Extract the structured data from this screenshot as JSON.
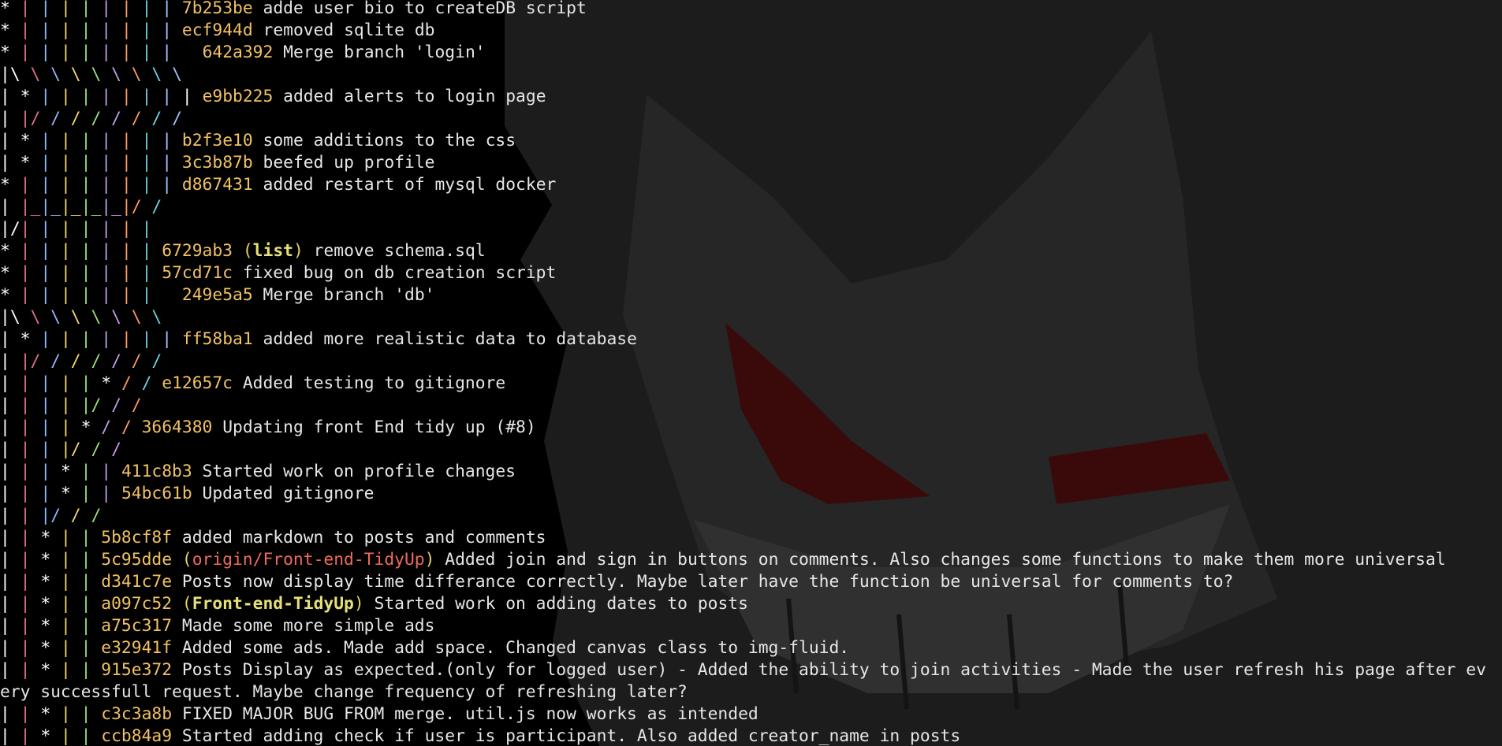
{
  "colors": {
    "background": "#000000",
    "hash": "#f2c263",
    "message": "#e6e6e6",
    "ref_local": "#e6e07a",
    "ref_remote": "#f06a5a",
    "wallpaper_figure": "#2a2a2a",
    "wallpaper_eyes": "#3d0b0b"
  },
  "wallpaper": {
    "description_icon": "gengar-wallpaper-icon"
  },
  "lines": [
    {
      "graph": "* | | | | | | | | ",
      "hash": "7b253be",
      "refs": "",
      "message": "adde user bio to createDB script"
    },
    {
      "graph": "* | | | | | | | | ",
      "hash": "ecf944d",
      "refs": "",
      "message": "removed sqlite db"
    },
    {
      "graph": "* | | | | | | | |   ",
      "hash": "642a392",
      "refs": "",
      "message": "Merge branch 'login'"
    },
    {
      "graph": "|\\ \\ \\ \\ \\ \\ \\ \\ \\",
      "hash": "",
      "refs": "",
      "message": ""
    },
    {
      "graph": "| * | | | | | | | | ",
      "hash": "e9bb225",
      "refs": "",
      "message": "added alerts to login page"
    },
    {
      "graph": "| |/ / / / / / / /",
      "hash": "",
      "refs": "",
      "message": ""
    },
    {
      "graph": "| * | | | | | | | ",
      "hash": "b2f3e10",
      "refs": "",
      "message": "some additions to the css"
    },
    {
      "graph": "| * | | | | | | | ",
      "hash": "3c3b87b",
      "refs": "",
      "message": "beefed up profile"
    },
    {
      "graph": "* | | | | | | | | ",
      "hash": "d867431",
      "refs": "",
      "message": "added restart of mysql docker"
    },
    {
      "graph": "| |_|_|_|_|_|/ /",
      "hash": "",
      "refs": "",
      "message": ""
    },
    {
      "graph": "|/| | | | | | |",
      "hash": "",
      "refs": "",
      "message": ""
    },
    {
      "graph": "* | | | | | | | ",
      "hash": "6729ab3",
      "refs": "list",
      "refType": "local",
      "message": "remove schema.sql"
    },
    {
      "graph": "* | | | | | | | ",
      "hash": "57cd71c",
      "refs": "",
      "message": "fixed bug on db creation script"
    },
    {
      "graph": "* | | | | | | |   ",
      "hash": "249e5a5",
      "refs": "",
      "message": "Merge branch 'db'"
    },
    {
      "graph": "|\\ \\ \\ \\ \\ \\ \\ \\",
      "hash": "",
      "refs": "",
      "message": ""
    },
    {
      "graph": "| * | | | | | | | ",
      "hash": "ff58ba1",
      "refs": "",
      "message": "added more realistic data to database"
    },
    {
      "graph": "| |/ / / / / / /",
      "hash": "",
      "refs": "",
      "message": ""
    },
    {
      "graph": "| | | | | * / / ",
      "hash": "e12657c",
      "refs": "",
      "message": "Added testing to gitignore"
    },
    {
      "graph": "| | | | |/ / /",
      "hash": "",
      "refs": "",
      "message": ""
    },
    {
      "graph": "| | | | * / / ",
      "hash": "3664380",
      "refs": "",
      "message": "Updating front End tidy up (#8)"
    },
    {
      "graph": "| | | |/ / /",
      "hash": "",
      "refs": "",
      "message": ""
    },
    {
      "graph": "| | | * | | ",
      "hash": "411c8b3",
      "refs": "",
      "message": "Started work on profile changes"
    },
    {
      "graph": "| | | * | | ",
      "hash": "54bc61b",
      "refs": "",
      "message": "Updated gitignore"
    },
    {
      "graph": "| | |/ / /",
      "hash": "",
      "refs": "",
      "message": ""
    },
    {
      "graph": "| | * | | ",
      "hash": "5b8cf8f",
      "refs": "",
      "message": "added markdown to posts and comments"
    },
    {
      "graph": "| | * | | ",
      "hash": "5c95dde",
      "refs": "origin/Front-end-TidyUp",
      "refType": "remote",
      "message": "Added join and sign in buttons on comments. Also changes some functions to make them more universal"
    },
    {
      "graph": "| | * | | ",
      "hash": "d341c7e",
      "refs": "",
      "message": "Posts now display time differance correctly. Maybe later have the function be universal for comments to?"
    },
    {
      "graph": "| | * | | ",
      "hash": "a097c52",
      "refs": "Front-end-TidyUp",
      "refType": "local",
      "message": "Started work on adding dates to posts"
    },
    {
      "graph": "| | * | | ",
      "hash": "a75c317",
      "refs": "",
      "message": "Made some more simple ads"
    },
    {
      "graph": "| | * | | ",
      "hash": "e32941f",
      "refs": "",
      "message": "Added some ads. Made add space. Changed canvas class to img-fluid."
    },
    {
      "graph": "| | * | | ",
      "hash": "915e372",
      "refs": "",
      "message": "Posts Display as expected.(only for logged user) - Added the ability to join activities - Made the user refresh his page after ev"
    },
    {
      "graph": "",
      "hash": "",
      "refs": "",
      "message": "ery successfull request. Maybe change frequency of refreshing later?"
    },
    {
      "graph": "| | * | | ",
      "hash": "c3c3a8b",
      "refs": "",
      "message": "FIXED MAJOR BUG FROM merge. util.js now works as intended"
    },
    {
      "graph": "| | * | | ",
      "hash": "ccb84a9",
      "refs": "",
      "message": "Started adding check if user is participant. Also added creator_name in posts"
    }
  ]
}
